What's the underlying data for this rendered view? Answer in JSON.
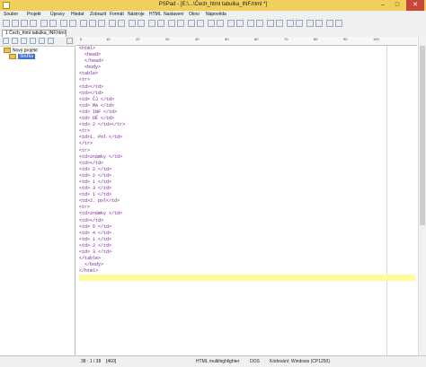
{
  "window": {
    "title": "PSPad - [E:\\...\\Čech_html tabulka_INF.html *]",
    "minimize": "–",
    "maximize": "□",
    "close": "✕"
  },
  "menu": [
    "Soubor",
    "Projekt",
    "Úpravy",
    "Hledat",
    "Zobrazit",
    "Formát",
    "Nástroje",
    "HTML",
    "Nastavení",
    "Okno",
    "Nápověda"
  ],
  "tab": {
    "label": "1 Čech_html tabulka_INF.html"
  },
  "tree": {
    "project": "Nový projekt",
    "folder": "Složka"
  },
  "ruler": [
    "0",
    "10",
    "20",
    "30",
    "40",
    "50",
    "60",
    "70",
    "80",
    "90",
    "100"
  ],
  "code": [
    "<html>",
    "  <head>",
    "  </head>",
    "  <body>",
    "<table>",
    "<tr>",
    "<td></td>",
    "<td></td>",
    "<td> ČJ </td>",
    "<td> MA </td>",
    "<td> INF </td>",
    "<td> DĚ </td>",
    "<td> 2 </td></tr>",
    "<tr>",
    "<td>1. Pol </td>",
    "</tr>",
    "<tr>",
    "<td>známky </td>",
    "<td></td>",
    "<td> 2 </td>",
    "<td> 2 </td>",
    "<td> 1 </td>",
    "<td> 3 </td>",
    "<td> 1 </td>",
    "<td>2. pol</td>",
    "<tr>",
    "<td>známky </td>",
    "<td></td>",
    "<td> 5 </td>",
    "<td> 4 </td>",
    "<td> 1 </td>",
    "<td> 2 </td>",
    "<td> 3 </td>",
    "</table>",
    "  </body>",
    "</html>",
    "",
    ""
  ],
  "status": {
    "position": "38 : 1 / 38",
    "chars": "[460]",
    "syntax": "HTML multihighlighter",
    "eol": "DOS",
    "encoding": "Kódování: Windows (CP1250)"
  }
}
